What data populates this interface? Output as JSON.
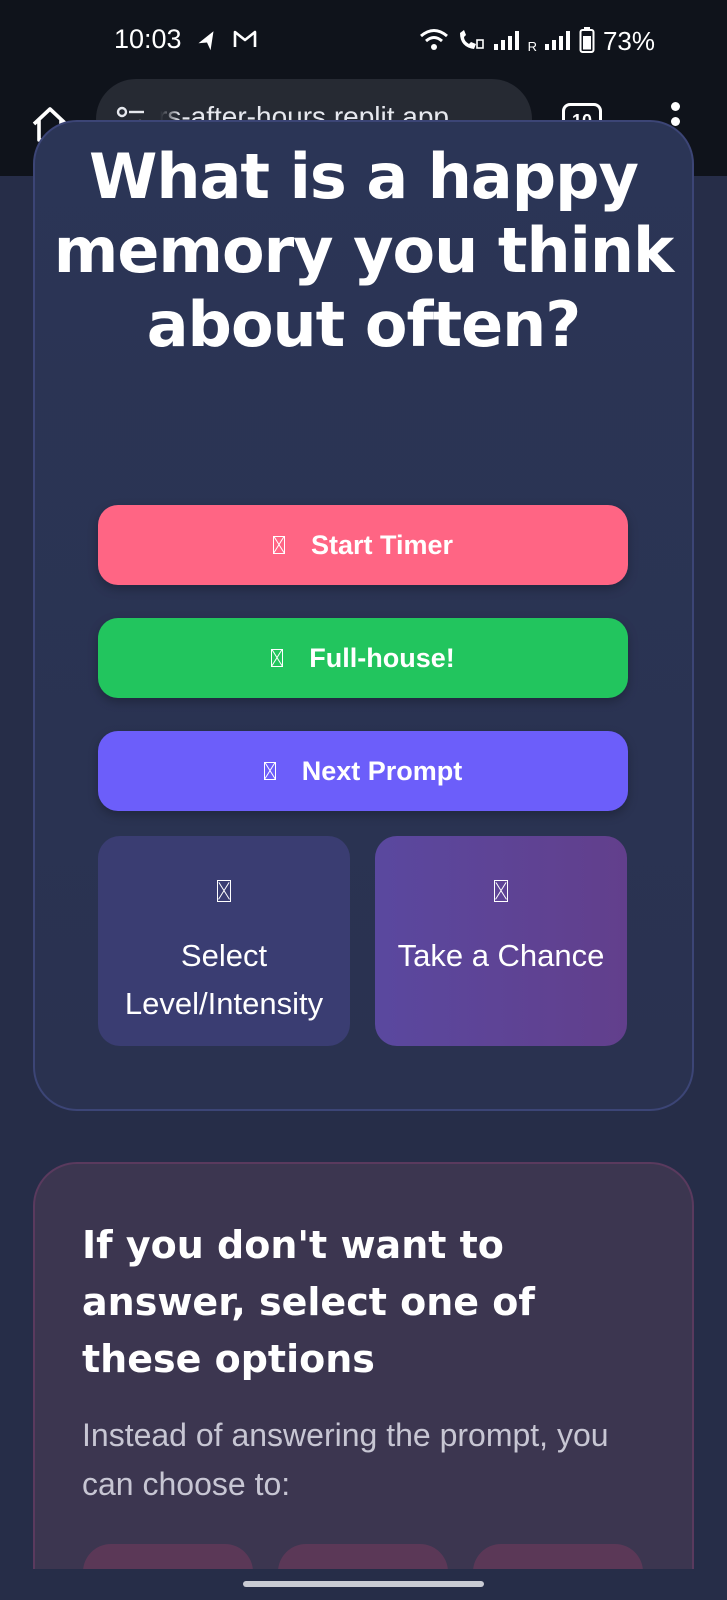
{
  "status_bar": {
    "time": "10:03",
    "battery": "73%",
    "roaming_indicator": "R",
    "icons": [
      "navigation-icon",
      "gmail-icon",
      "wifi-icon",
      "wifi-calling-icon",
      "signal-icon",
      "signal-roaming-icon",
      "battery-icon"
    ]
  },
  "browser": {
    "url": "rs-after-hours.replit.app",
    "tab_count": "10",
    "icons": [
      "home-icon",
      "site-settings-icon",
      "menu-icon"
    ]
  },
  "prompt": {
    "text": "What is a happy memory you think about often?"
  },
  "actions": {
    "start_timer": {
      "icon": "timer-icon",
      "label": "Start Timer"
    },
    "full_house": {
      "icon": "full-house-icon",
      "label": "Full-house!"
    },
    "next_prompt": {
      "icon": "next-icon",
      "label": "Next Prompt"
    },
    "select_level": {
      "icon": "level-icon",
      "label": "Select Level/Intensity"
    },
    "take_chance": {
      "icon": "dice-icon",
      "label": "Take a Chance"
    }
  },
  "skip_section": {
    "title": "If you don't want to answer, select one of these options",
    "description": "Instead of answering the prompt, you can choose to:"
  },
  "colors": {
    "page_background": "#262d48",
    "start_timer": "#ff6584",
    "full_house": "#22c55e",
    "next_prompt": "#6c5efa",
    "select_level": "#3a3d72",
    "take_chance": "#5a489f"
  }
}
